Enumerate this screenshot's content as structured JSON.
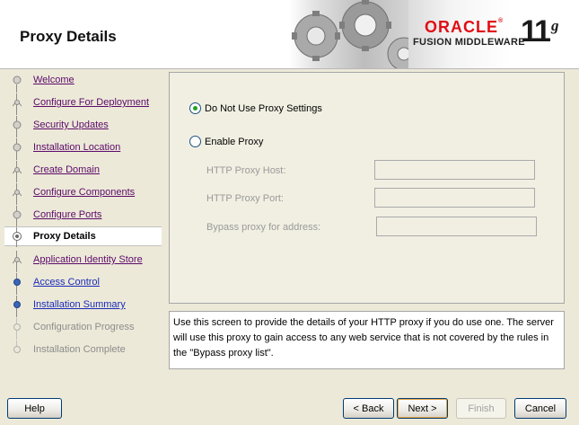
{
  "header": {
    "title": "Proxy Details",
    "brand": {
      "oracle": "ORACLE",
      "registered": "®",
      "product": "FUSION MIDDLEWARE",
      "version_number": "11",
      "version_letter": "g",
      "oracle_color": "#e10e15"
    }
  },
  "nav": {
    "items": [
      {
        "label": "Welcome",
        "state": "done"
      },
      {
        "label": "Configure For Deployment",
        "state": "done"
      },
      {
        "label": "Security Updates",
        "state": "done"
      },
      {
        "label": "Installation Location",
        "state": "done"
      },
      {
        "label": "Create Domain",
        "state": "done"
      },
      {
        "label": "Configure Components",
        "state": "done"
      },
      {
        "label": "Configure Ports",
        "state": "done"
      },
      {
        "label": "Proxy Details",
        "state": "current"
      },
      {
        "label": "Application Identity Store",
        "state": "done"
      },
      {
        "label": "Access Control",
        "state": "link"
      },
      {
        "label": "Installation Summary",
        "state": "link"
      },
      {
        "label": "Configuration Progress",
        "state": "disabled"
      },
      {
        "label": "Installation Complete",
        "state": "disabled"
      }
    ]
  },
  "proxy": {
    "no_proxy_label": "Do Not Use Proxy Settings",
    "enable_proxy_label": "Enable Proxy",
    "selected": "no_proxy",
    "http_host_label": "HTTP Proxy Host:",
    "http_host_value": "",
    "http_port_label": "HTTP Proxy Port:",
    "http_port_value": "",
    "bypass_label": "Bypass proxy for address:",
    "bypass_value": ""
  },
  "help_text": "Use this screen to provide the details of your HTTP proxy if you do use one. The server will use this proxy to gain access to any web service that is not covered by the rules in the \"Bypass proxy list\".",
  "buttons": {
    "help": "Help",
    "back": "< Back",
    "next": "Next >",
    "finish": "Finish",
    "cancel": "Cancel"
  }
}
